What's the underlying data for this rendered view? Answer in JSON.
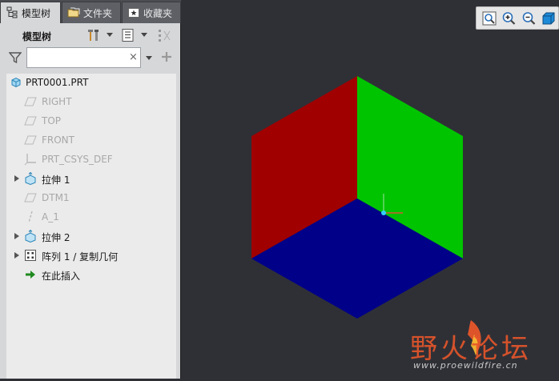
{
  "tabs": [
    {
      "label": "模型树",
      "icon": "model-tree-icon",
      "active": true
    },
    {
      "label": "文件夹",
      "icon": "folder-icon",
      "active": false
    },
    {
      "label": "收藏夹",
      "icon": "favorites-icon",
      "active": false
    }
  ],
  "toolbar": {
    "title": "模型树",
    "settings_icon": "tools-icon",
    "show_icon": "list-icon",
    "columns_icon": "columns-icon"
  },
  "filter": {
    "value": "",
    "placeholder": "",
    "clear_label": "×"
  },
  "tree": {
    "root": "PRT0001.PRT",
    "items": [
      {
        "label": "RIGHT",
        "icon": "datum-plane-icon",
        "disabled": true,
        "expandable": false
      },
      {
        "label": "TOP",
        "icon": "datum-plane-icon",
        "disabled": true,
        "expandable": false
      },
      {
        "label": "FRONT",
        "icon": "datum-plane-icon",
        "disabled": true,
        "expandable": false
      },
      {
        "label": "PRT_CSYS_DEF",
        "icon": "csys-icon",
        "disabled": true,
        "expandable": false
      },
      {
        "label": "拉伸 1",
        "icon": "extrude-icon",
        "disabled": false,
        "expandable": true
      },
      {
        "label": "DTM1",
        "icon": "datum-plane-icon",
        "disabled": true,
        "expandable": false
      },
      {
        "label": "A_1",
        "icon": "axis-icon",
        "disabled": true,
        "expandable": false
      },
      {
        "label": "拉伸 2",
        "icon": "extrude-icon",
        "disabled": false,
        "expandable": true
      },
      {
        "label": "阵列 1 / 复制几何",
        "icon": "pattern-icon",
        "disabled": false,
        "expandable": true
      },
      {
        "label": "在此插入",
        "icon": "insert-here-icon",
        "disabled": false,
        "expandable": false
      }
    ]
  },
  "view_toolbar": {
    "buttons": [
      "refit-icon",
      "zoom-in-icon",
      "zoom-out-icon",
      "shading-icon"
    ]
  },
  "cube": {
    "left_face_color": "#a00000",
    "right_face_color": "#00c400",
    "bottom_face_color": "#000088"
  },
  "watermark": {
    "brand": "野火论坛",
    "url": "www.proewildfire.cn"
  }
}
